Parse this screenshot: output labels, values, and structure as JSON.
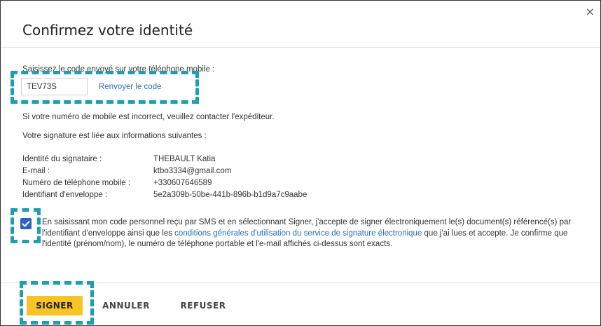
{
  "dialog": {
    "title": "Confirmez votre identité",
    "close_glyph": "×"
  },
  "code": {
    "prompt": "Saisissez le code envoyé sur votre téléphone mobile :",
    "value": "TEV73S",
    "resend_label": "Renvoyer le code"
  },
  "notice": "Si votre numéro de mobile est incorrect, veuillez contacter l'expéditeur.",
  "info": {
    "intro": "Votre signature est liée aux informations suivantes :",
    "rows": [
      {
        "label": "Identité du signataire :",
        "value": "THEBAULT Katia"
      },
      {
        "label": "E-mail :",
        "value": "ktbo3334@gmail.com"
      },
      {
        "label": "Numéro de téléphone mobile :",
        "value": "+330607646589"
      },
      {
        "label": "Identifiant d'enveloppe :",
        "value": "5e2a309b-50be-441b-896b-b1d9a7c9aabe"
      }
    ]
  },
  "consent": {
    "checked": true,
    "text_before": "En saisissant mon code personnel reçu par SMS et en sélectionnant Signer, j'accepte de signer électroniquement le(s) document(s) référencé(s) par l'identifiant d'enveloppe ainsi que les ",
    "link": "conditions générales d'utilisation du service de signature électronique",
    "text_after": " que j'ai lues et accepte. Je confirme que l'identité (prénom/nom), le numéro de téléphone portable et l'e-mail affichés ci-dessus sont exacts."
  },
  "buttons": {
    "sign": "SIGNER",
    "cancel": "ANNULER",
    "refuse": "REFUSER"
  },
  "colors": {
    "primary_button": "#f7c325",
    "link": "#2a6db0",
    "checkbox": "#2a63c4",
    "highlight": "#1b9fb1"
  }
}
